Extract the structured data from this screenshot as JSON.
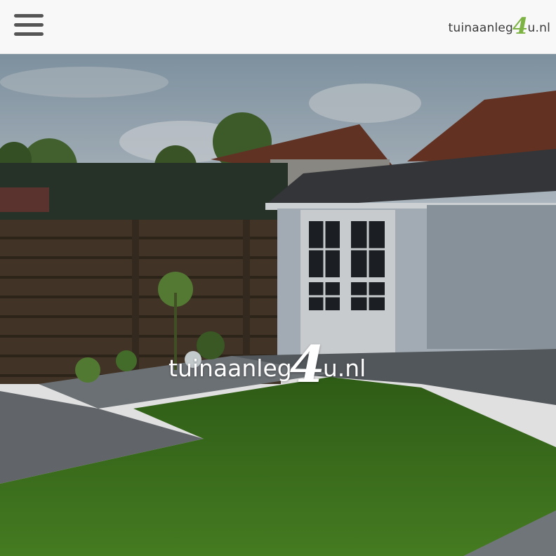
{
  "header": {
    "menu_icon": "hamburger-menu-icon",
    "logo": {
      "prefix": "tuinaanleg",
      "numeral": "4",
      "suffix": "u.nl"
    }
  },
  "hero": {
    "logo": {
      "prefix": "tuinaanleg",
      "numeral": "4",
      "suffix": "u.nl"
    },
    "image_subject": "garden with wooden fence, grey log cabin with veranda, lawn and paving",
    "colors": {
      "sky": "#aebfcc",
      "lawn": "#3f7a1e",
      "fence": "#4a3b2c",
      "cabin": "#b9c3cc",
      "roof": "#3b3d40",
      "tiles": "#6f7479",
      "brand_green": "#7cb342"
    }
  }
}
